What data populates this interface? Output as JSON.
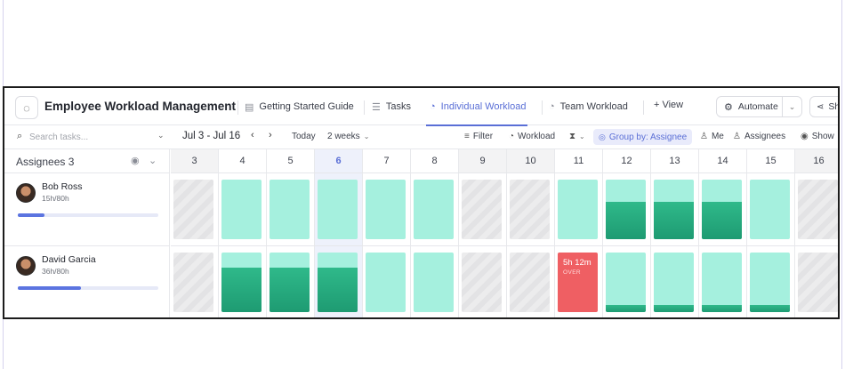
{
  "header": {
    "title": "Employee Workload Management",
    "tabs": [
      {
        "label": "Getting Started Guide",
        "icon": "doc-icon"
      },
      {
        "label": "Tasks",
        "icon": "list-icon"
      },
      {
        "label": "Individual Workload",
        "icon": "gauge-icon",
        "active": true
      },
      {
        "label": "Team Workload",
        "icon": "gauge-icon"
      }
    ],
    "add_view_label": "+ View",
    "automate_label": "Automate",
    "share_label": "Sha"
  },
  "toolbar": {
    "search_placeholder": "Search tasks...",
    "date_range": "Jul 3 - Jul 16",
    "today_label": "Today",
    "period_label": "2 weeks",
    "filter_label": "Filter",
    "workload_label": "Workload",
    "group_by_label": "Group by: Assignee",
    "me_label": "Me",
    "assignees_label": "Assignees",
    "show_label": "Show"
  },
  "grid": {
    "assignees_header": "Assignees",
    "assignees_count": "3",
    "days": [
      "3",
      "4",
      "5",
      "6",
      "7",
      "8",
      "9",
      "10",
      "11",
      "12",
      "13",
      "14",
      "15",
      "16"
    ],
    "weekend_days": [
      "3",
      "9",
      "10",
      "16"
    ],
    "today": "6"
  },
  "rows": [
    {
      "name": "Bob Ross",
      "hours": "15h/80h",
      "progress": 0.19,
      "cells": [
        {
          "state": "off"
        },
        {
          "state": "free",
          "load": 0
        },
        {
          "state": "free",
          "load": 0
        },
        {
          "state": "free",
          "load": 0
        },
        {
          "state": "free",
          "load": 0
        },
        {
          "state": "free",
          "load": 0
        },
        {
          "state": "off"
        },
        {
          "state": "off"
        },
        {
          "state": "free",
          "load": 0
        },
        {
          "state": "free",
          "load": 0.62
        },
        {
          "state": "free",
          "load": 0.62
        },
        {
          "state": "free",
          "load": 0.62
        },
        {
          "state": "free",
          "load": 0
        },
        {
          "state": "off"
        }
      ]
    },
    {
      "name": "David Garcia",
      "hours": "36h/80h",
      "progress": 0.45,
      "cells": [
        {
          "state": "off"
        },
        {
          "state": "free",
          "load": 0.75
        },
        {
          "state": "free",
          "load": 0.75
        },
        {
          "state": "free",
          "load": 0.75
        },
        {
          "state": "free",
          "load": 0
        },
        {
          "state": "free",
          "load": 0
        },
        {
          "state": "off"
        },
        {
          "state": "off"
        },
        {
          "state": "over",
          "over_hours": "5h 12m",
          "over_label": "OVER"
        },
        {
          "state": "free",
          "load": 0.12
        },
        {
          "state": "free",
          "load": 0.12
        },
        {
          "state": "free",
          "load": 0.12
        },
        {
          "state": "free",
          "load": 0.12
        },
        {
          "state": "off"
        }
      ]
    }
  ]
}
